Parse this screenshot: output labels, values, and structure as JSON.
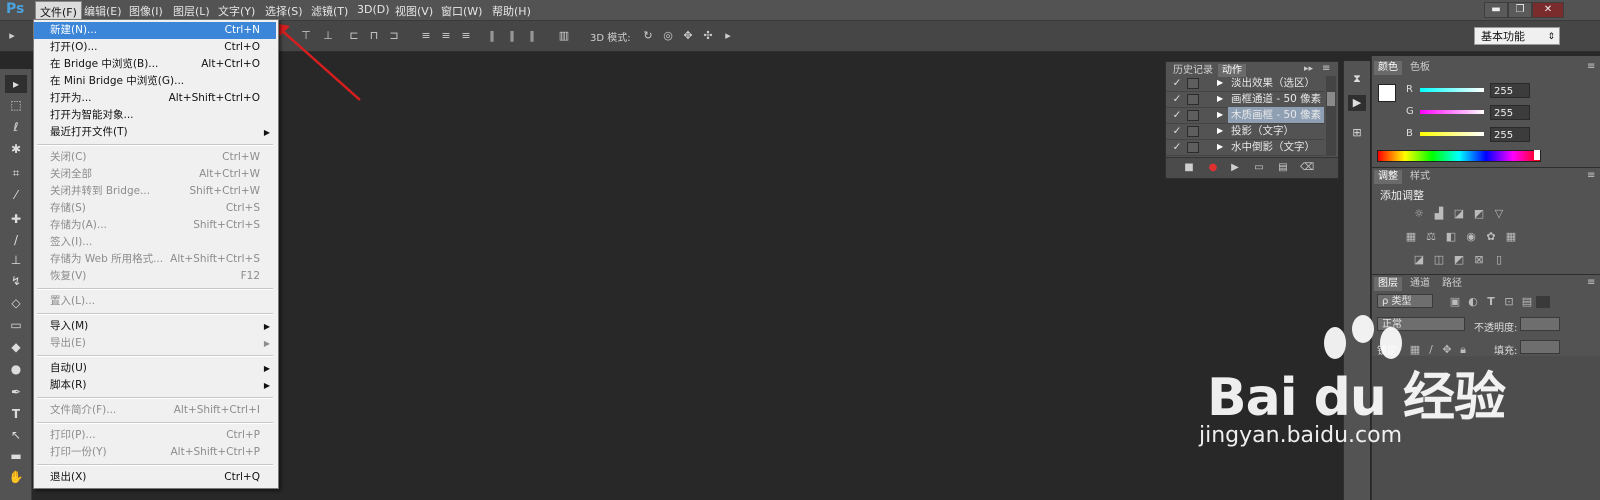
{
  "app": {
    "logo": "Ps"
  },
  "menubar": [
    {
      "label": "文件(F)"
    },
    {
      "label": "编辑(E)"
    },
    {
      "label": "图像(I)"
    },
    {
      "label": "图层(L)"
    },
    {
      "label": "文字(Y)"
    },
    {
      "label": "选择(S)"
    },
    {
      "label": "滤镜(T)"
    },
    {
      "label": "3D(D)"
    },
    {
      "label": "视图(V)"
    },
    {
      "label": "窗口(W)"
    },
    {
      "label": "帮助(H)"
    }
  ],
  "window_controls": {
    "minimize": "▬",
    "restore": "❐",
    "close": "✕"
  },
  "options_bar": {
    "mode_3d_label": "3D 模式:",
    "workspace": "基本功能"
  },
  "file_menu": {
    "items": [
      {
        "label": "新建(N)...",
        "shortcut": "Ctrl+N",
        "state": "highlighted"
      },
      {
        "label": "打开(O)...",
        "shortcut": "Ctrl+O",
        "state": "enabled"
      },
      {
        "label": "在 Bridge 中浏览(B)...",
        "shortcut": "Alt+Ctrl+O",
        "state": "enabled"
      },
      {
        "label": "在 Mini Bridge 中浏览(G)...",
        "shortcut": "",
        "state": "enabled"
      },
      {
        "label": "打开为...",
        "shortcut": "Alt+Shift+Ctrl+O",
        "state": "enabled"
      },
      {
        "label": "打开为智能对象...",
        "shortcut": "",
        "state": "enabled"
      },
      {
        "label": "最近打开文件(T)",
        "shortcut": "",
        "state": "submenu"
      },
      {
        "label": "关闭(C)",
        "shortcut": "Ctrl+W",
        "state": "disabled"
      },
      {
        "label": "关闭全部",
        "shortcut": "Alt+Ctrl+W",
        "state": "disabled"
      },
      {
        "label": "关闭并转到 Bridge...",
        "shortcut": "Shift+Ctrl+W",
        "state": "disabled"
      },
      {
        "label": "存储(S)",
        "shortcut": "Ctrl+S",
        "state": "disabled"
      },
      {
        "label": "存储为(A)...",
        "shortcut": "Shift+Ctrl+S",
        "state": "disabled"
      },
      {
        "label": "签入(I)...",
        "shortcut": "",
        "state": "disabled"
      },
      {
        "label": "存储为 Web 所用格式...",
        "shortcut": "Alt+Shift+Ctrl+S",
        "state": "disabled"
      },
      {
        "label": "恢复(V)",
        "shortcut": "F12",
        "state": "disabled"
      },
      {
        "label": "置入(L)...",
        "shortcut": "",
        "state": "disabled"
      },
      {
        "label": "导入(M)",
        "shortcut": "",
        "state": "submenu"
      },
      {
        "label": "导出(E)",
        "shortcut": "",
        "state": "submenu-disabled"
      },
      {
        "label": "自动(U)",
        "shortcut": "",
        "state": "submenu"
      },
      {
        "label": "脚本(R)",
        "shortcut": "",
        "state": "submenu"
      },
      {
        "label": "文件简介(F)...",
        "shortcut": "Alt+Shift+Ctrl+I",
        "state": "disabled"
      },
      {
        "label": "打印(P)...",
        "shortcut": "Ctrl+P",
        "state": "disabled"
      },
      {
        "label": "打印一份(Y)",
        "shortcut": "Alt+Shift+Ctrl+P",
        "state": "disabled"
      },
      {
        "label": "退出(X)",
        "shortcut": "Ctrl+Q",
        "state": "enabled"
      }
    ]
  },
  "actions_panel": {
    "tabs": [
      {
        "label": "历史记录"
      },
      {
        "label": "动作"
      }
    ],
    "rows": [
      {
        "label": "淡出效果（选区）",
        "checked": "✓",
        "highlighted": false
      },
      {
        "label": "画框通道 - 50 像素",
        "checked": "✓",
        "highlighted": false
      },
      {
        "label": "木质画框 - 50 像素",
        "checked": "✓",
        "highlighted": true
      },
      {
        "label": "投影（文字）",
        "checked": "✓",
        "highlighted": false
      },
      {
        "label": "水中倒影（文字）",
        "checked": "✓",
        "highlighted": false
      }
    ]
  },
  "color_panel": {
    "tabs": [
      {
        "label": "颜色"
      },
      {
        "label": "色板"
      }
    ],
    "channels": [
      {
        "name": "R",
        "value": "255",
        "color": "#00d8d8"
      },
      {
        "name": "G",
        "value": "255",
        "color": "#d040d0"
      },
      {
        "name": "B",
        "value": "255",
        "color": "#e8e800"
      }
    ]
  },
  "adjust_panel": {
    "tabs": [
      {
        "label": "调整"
      },
      {
        "label": "样式"
      }
    ],
    "title": "添加调整"
  },
  "layers_panel": {
    "tabs": [
      {
        "label": "图层"
      },
      {
        "label": "通道"
      },
      {
        "label": "路径"
      }
    ],
    "filter_kind": "ρ 类型",
    "blend_mode": "正常",
    "opacity_label": "不透明度:",
    "lock_label": "锁定:",
    "fill_label": "填充:"
  },
  "watermark": {
    "brand": "Bai du 经验",
    "url": "jingyan.baidu.com"
  }
}
